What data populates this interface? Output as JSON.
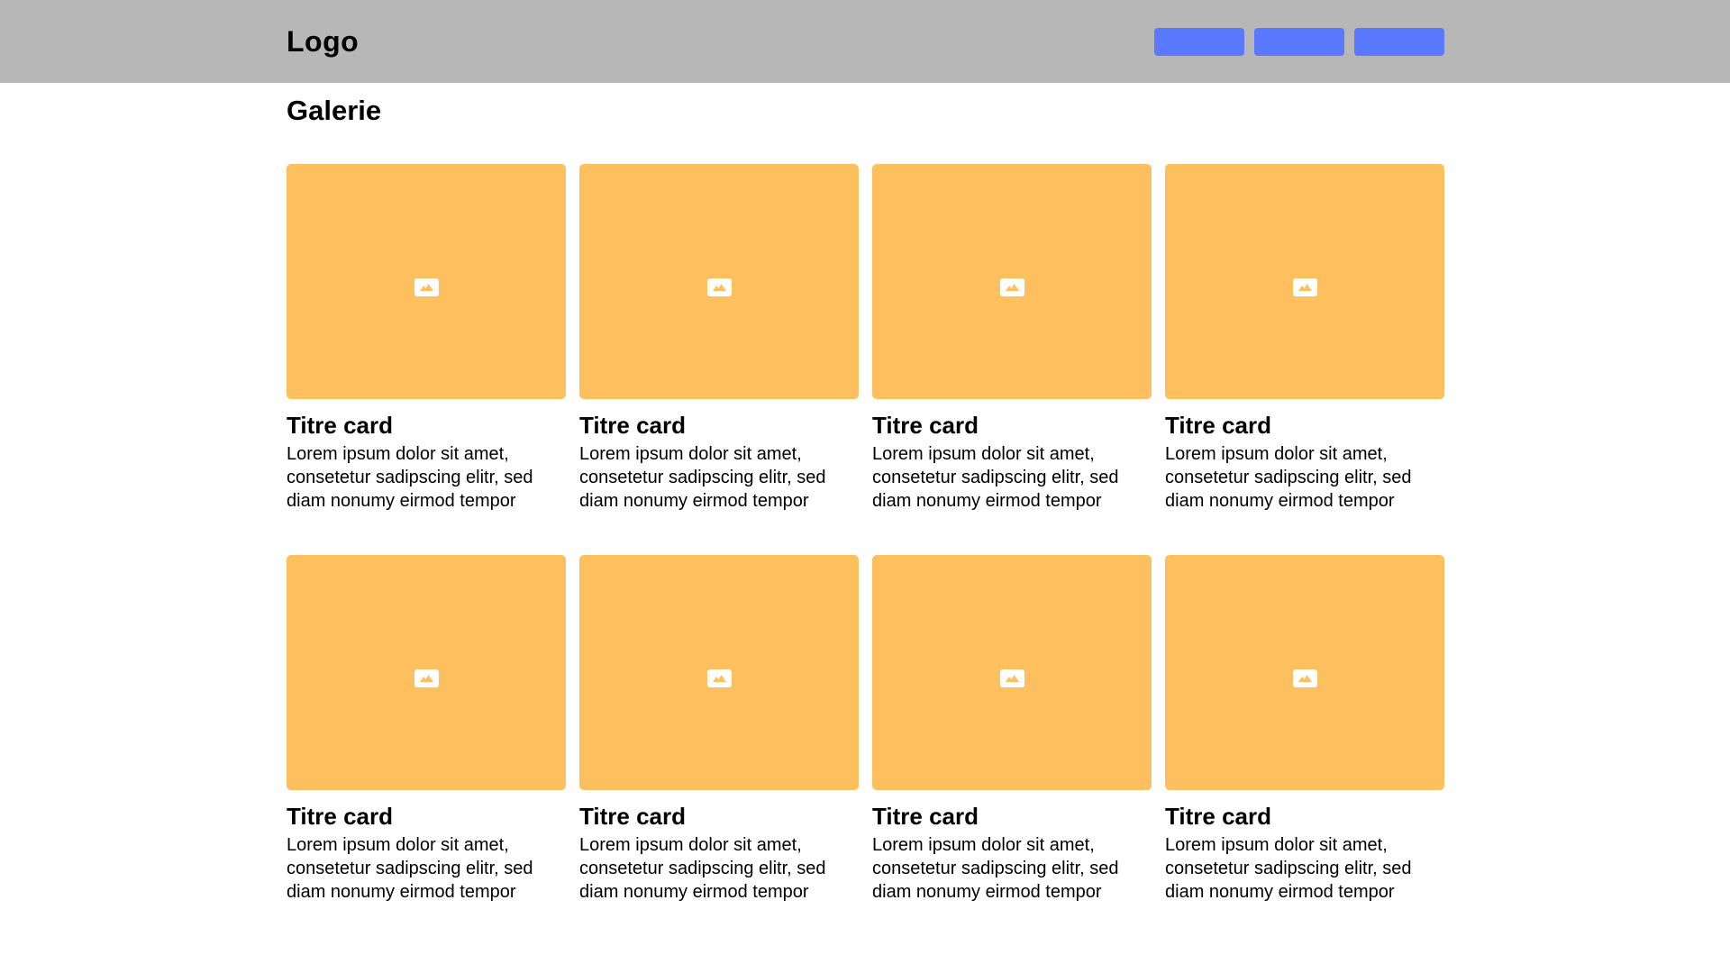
{
  "colors": {
    "header_bg": "#b7b7b7",
    "nav_button": "#5b79ff",
    "card_image": "#febf5e",
    "icon_bg": "#ffffff"
  },
  "header": {
    "logo": "Logo",
    "nav_buttons": [
      "",
      "",
      ""
    ]
  },
  "main": {
    "title": "Galerie",
    "cards": [
      {
        "title": "Titre card",
        "text": "Lorem ipsum dolor sit amet, consetetur sadipscing elitr, sed diam nonumy eirmod tempor",
        "icon": "image-icon"
      },
      {
        "title": "Titre card",
        "text": "Lorem ipsum dolor sit amet, consetetur sadipscing elitr, sed diam nonumy eirmod tempor",
        "icon": "image-icon"
      },
      {
        "title": "Titre card",
        "text": "Lorem ipsum dolor sit amet, consetetur sadipscing elitr, sed diam nonumy eirmod tempor",
        "icon": "image-icon"
      },
      {
        "title": "Titre card",
        "text": "Lorem ipsum dolor sit amet, consetetur sadipscing elitr, sed diam nonumy eirmod tempor",
        "icon": "image-icon"
      },
      {
        "title": "Titre card",
        "text": "Lorem ipsum dolor sit amet, consetetur sadipscing elitr, sed diam nonumy eirmod tempor",
        "icon": "image-icon"
      },
      {
        "title": "Titre card",
        "text": "Lorem ipsum dolor sit amet, consetetur sadipscing elitr, sed diam nonumy eirmod tempor",
        "icon": "image-icon"
      },
      {
        "title": "Titre card",
        "text": "Lorem ipsum dolor sit amet, consetetur sadipscing elitr, sed diam nonumy eirmod tempor",
        "icon": "image-icon"
      },
      {
        "title": "Titre card",
        "text": "Lorem ipsum dolor sit amet, consetetur sadipscing elitr, sed diam nonumy eirmod tempor",
        "icon": "image-icon"
      }
    ]
  }
}
